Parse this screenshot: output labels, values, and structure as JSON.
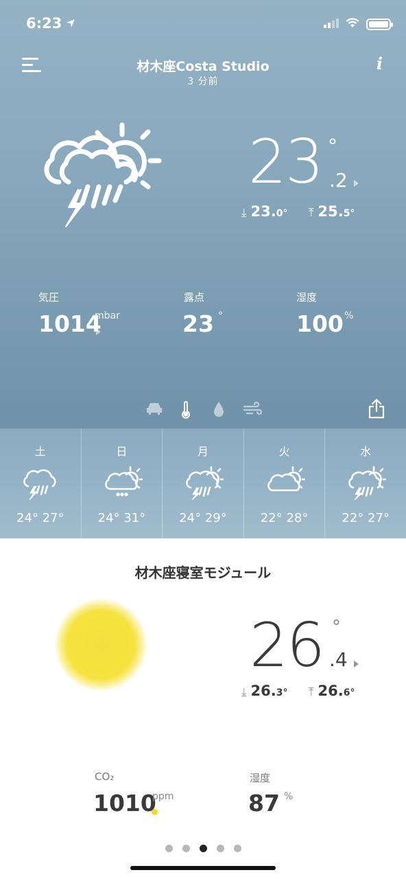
{
  "status": {
    "time": "6:23"
  },
  "header": {
    "title": "材木座Costa Studio",
    "subtitle": "3 分前"
  },
  "outdoor": {
    "temp_int": "23",
    "temp_dec": ".2",
    "degree": "°",
    "min": "23.",
    "min_dec": "0°",
    "max": "25.",
    "max_dec": "5°",
    "stats": [
      {
        "label": "気圧",
        "value": "1014",
        "unit": "mbar"
      },
      {
        "label": "露点",
        "value": "23",
        "unit": "°"
      },
      {
        "label": "湿度",
        "value": "100",
        "unit": "%"
      }
    ],
    "tabs": [
      "car-icon",
      "thermometer-icon",
      "drop-icon",
      "wind-icon"
    ]
  },
  "forecast": [
    {
      "day": "土",
      "range": "24° 27°",
      "icon": "thunderstorm-icon"
    },
    {
      "day": "日",
      "range": "24° 31°",
      "icon": "drizzle-sun-icon"
    },
    {
      "day": "月",
      "range": "24° 29°",
      "icon": "thunderstorm-sun-icon"
    },
    {
      "day": "火",
      "range": "22° 28°",
      "icon": "cloud-sun-icon"
    },
    {
      "day": "水",
      "range": "22° 27°",
      "icon": "thunderstorm-sun-icon"
    }
  ],
  "module": {
    "title": "材木座寝室モジュール",
    "temp_int": "26",
    "temp_dec": ".4",
    "degree": "°",
    "min": "26.",
    "min_dec": "3°",
    "max": "26.",
    "max_dec": "6°",
    "co2_label": "CO₂",
    "co2_value": "1010",
    "co2_unit": "ppm",
    "co2_status_color": "#f1dc1a",
    "hum_label": "湿度",
    "hum_value": "87",
    "hum_unit": "%"
  },
  "pager": {
    "count": 5,
    "active": 3
  }
}
